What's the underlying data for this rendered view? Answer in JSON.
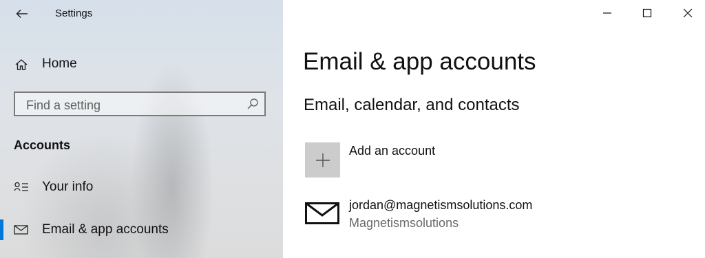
{
  "window": {
    "title": "Settings",
    "controls": {
      "minimize": "minimize-icon",
      "maximize": "maximize-icon",
      "close": "close-icon"
    }
  },
  "sidebar": {
    "home_label": "Home",
    "search_placeholder": "Find a setting",
    "section_heading": "Accounts",
    "items": [
      {
        "label": "Your info",
        "icon": "person-list-icon",
        "active": false
      },
      {
        "label": "Email & app accounts",
        "icon": "mail-icon",
        "active": true
      }
    ]
  },
  "main": {
    "title": "Email & app accounts",
    "subtitle": "Email, calendar, and contacts",
    "add_account_label": "Add an account",
    "accounts": [
      {
        "email": "jordan@magnetismsolutions.com",
        "name": "Magnetismsolutions",
        "icon": "mail-icon"
      }
    ]
  },
  "colors": {
    "accent": "#0078d7",
    "tile": "#cccccc",
    "secondary_text": "#6a6a6a"
  }
}
